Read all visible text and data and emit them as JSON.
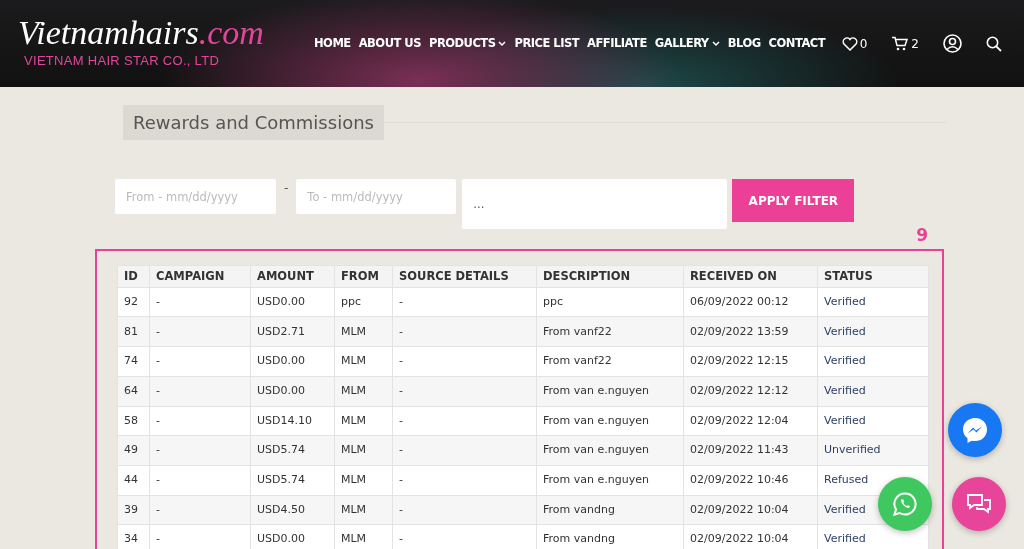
{
  "logo": {
    "name": "Vietnamhairs",
    "suffix": ".com",
    "tagline": "VIETNAM HAIR STAR CO., LTD"
  },
  "nav": [
    {
      "label": "HOME",
      "dropdown": false
    },
    {
      "label": "ABOUT US",
      "dropdown": false
    },
    {
      "label": "PRODUCTS",
      "dropdown": true
    },
    {
      "label": "PRICE LIST",
      "dropdown": false
    },
    {
      "label": "AFFILIATE",
      "dropdown": false
    },
    {
      "label": "GALLERY",
      "dropdown": true
    },
    {
      "label": "BLOG",
      "dropdown": false
    },
    {
      "label": "CONTACT",
      "dropdown": false
    }
  ],
  "header_icons": {
    "wishlist_count": "0",
    "cart_count": "2"
  },
  "section_title": "Rewards and Commissions",
  "filter": {
    "from_placeholder": "From - mm/dd/yyyy",
    "separator": "-",
    "to_placeholder": "To - mm/dd/yyyy",
    "search_value": "...",
    "button": "APPLY FILTER"
  },
  "total_count": "9",
  "table": {
    "columns": [
      "ID",
      "CAMPAIGN",
      "AMOUNT",
      "FROM",
      "SOURCE DETAILS",
      "DESCRIPTION",
      "RECEIVED ON",
      "STATUS"
    ],
    "rows": [
      [
        "92",
        "-",
        "USD0.00",
        "ppc",
        "-",
        "ppc",
        "06/09/2022 00:12",
        "Verified"
      ],
      [
        "81",
        "-",
        "USD2.71",
        "MLM",
        "-",
        "From vanf22",
        "02/09/2022 13:59",
        "Verified"
      ],
      [
        "74",
        "-",
        "USD0.00",
        "MLM",
        "-",
        "From vanf22",
        "02/09/2022 12:15",
        "Verified"
      ],
      [
        "64",
        "-",
        "USD0.00",
        "MLM",
        "-",
        "From van e.nguyen",
        "02/09/2022 12:12",
        "Verified"
      ],
      [
        "58",
        "-",
        "USD14.10",
        "MLM",
        "-",
        "From van e.nguyen",
        "02/09/2022 12:04",
        "Verified"
      ],
      [
        "49",
        "-",
        "USD5.74",
        "MLM",
        "-",
        "From van e.nguyen",
        "02/09/2022 11:43",
        "Unverified"
      ],
      [
        "44",
        "-",
        "USD5.74",
        "MLM",
        "-",
        "From van e.nguyen",
        "02/09/2022 10:46",
        "Refused"
      ],
      [
        "39",
        "-",
        "USD4.50",
        "MLM",
        "-",
        "From vandng",
        "02/09/2022 10:04",
        "Verified"
      ],
      [
        "34",
        "-",
        "USD0.00",
        "MLM",
        "-",
        "From vandng",
        "02/09/2022 10:04",
        "Verified"
      ]
    ]
  }
}
